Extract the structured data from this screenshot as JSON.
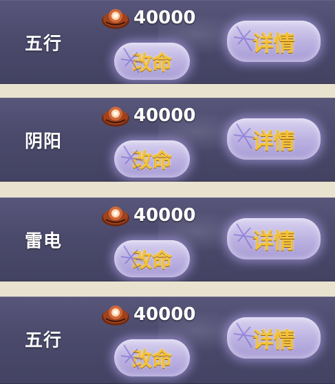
{
  "rows": [
    {
      "name": "五行",
      "cost": "40000",
      "change_label": "改命",
      "detail_label": "详情"
    },
    {
      "name": "阴阳",
      "cost": "40000",
      "change_label": "改命",
      "detail_label": "详情"
    },
    {
      "name": "雷电",
      "cost": "40000",
      "change_label": "改命",
      "detail_label": "详情"
    },
    {
      "name": "五行",
      "cost": "40000",
      "change_label": "改命",
      "detail_label": "详情"
    }
  ],
  "icons": {
    "currency": "red-orb-coin-icon",
    "rune": "purple-rune-icon"
  },
  "colors": {
    "row_bg": "#4b4a6c",
    "separator": "#e9e2cf",
    "button_text": "#f4c23a",
    "button_bg": "#bdb3e2"
  }
}
